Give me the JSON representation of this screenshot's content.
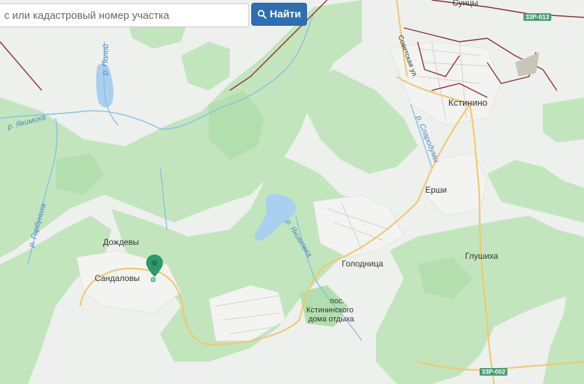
{
  "search": {
    "placeholder": "с или кадастровый номер участка",
    "button_label": "Найти"
  },
  "map": {
    "places": {
      "sunzy": "Сунцы",
      "kstinino": "Кстинино",
      "ershi": "Ерши",
      "dozhdevy": "Дождевы",
      "sandalovy": "Сандаловы",
      "golodnitsa": "Голодница",
      "glushikha": "Глушиха",
      "pos_line1": "пос.",
      "pos_line2": "Кстининского",
      "pos_line3": "дома отдыха"
    },
    "rivers": {
      "polom": "р. Полой",
      "yakimikha": "р. Якимиха",
      "gorbunikha": "р. Горбуниха",
      "yakimovka": "р. Якимовка",
      "sparodumy": "р. Спародумы"
    },
    "streets": {
      "sovetskaya": "Советская ул."
    },
    "roads": {
      "r013": "33Р-013",
      "r002": "33Р-002"
    },
    "colors": {
      "forest": "#bfe3bb",
      "forest_dark": "#ade0a8",
      "open": "#eef0ee",
      "water": "#a9d0ef",
      "river": "#87bde6",
      "road": "#f2c76d",
      "boundary": "#8a2a2a",
      "marker": "#2a9a6b",
      "button": "#2f6eb0"
    },
    "marker_icon": "map-pin-icon"
  }
}
